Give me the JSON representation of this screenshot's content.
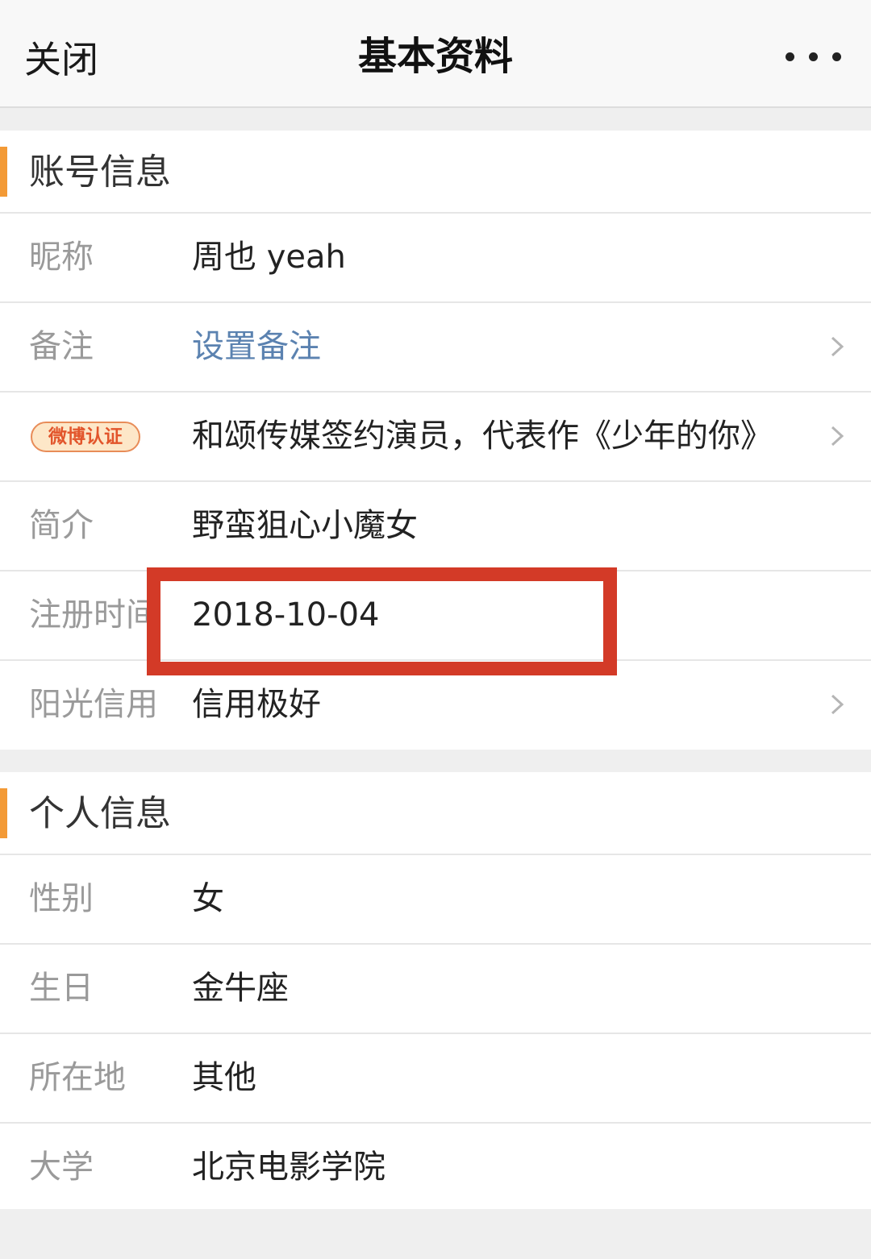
{
  "header": {
    "close_label": "关闭",
    "title": "基本资料",
    "more_icon": "more-dots-icon"
  },
  "account_section": {
    "title": "账号信息",
    "rows": [
      {
        "label": "昵称",
        "value": "周也 yeah"
      },
      {
        "label": "备注",
        "value": "设置备注"
      },
      {
        "badge": "微博认证",
        "value": "和颂传媒签约演员，代表作《少年的你》"
      },
      {
        "label": "简介",
        "value": "野蛮狙心小魔女"
      },
      {
        "label": "注册时间",
        "value": "2018-10-04"
      },
      {
        "label": "阳光信用",
        "value": "信用极好"
      }
    ]
  },
  "personal_section": {
    "title": "个人信息",
    "rows": [
      {
        "label": "性别",
        "value": "女"
      },
      {
        "label": "生日",
        "value": "金牛座"
      },
      {
        "label": "所在地",
        "value": "其他"
      },
      {
        "label": "大学",
        "value": "北京电影学院"
      }
    ]
  },
  "colors": {
    "accent": "#f39a36",
    "link": "#5b82b0",
    "highlight": "#d33a27"
  }
}
